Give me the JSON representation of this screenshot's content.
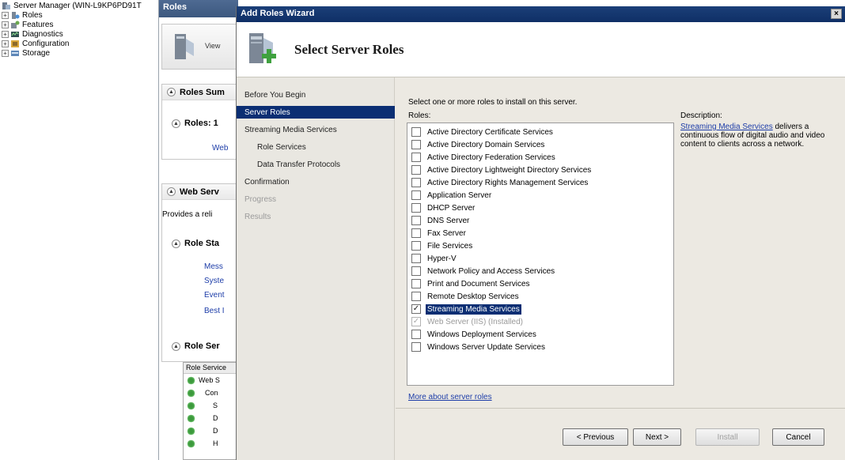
{
  "tree": {
    "root_label": "Server Manager (WIN-L9KP6PD91T",
    "items": [
      {
        "label": "Roles"
      },
      {
        "label": "Features"
      },
      {
        "label": "Diagnostics"
      },
      {
        "label": "Configuration"
      },
      {
        "label": "Storage"
      }
    ]
  },
  "mid": {
    "header": "Roles",
    "banner_text": "View",
    "roles_summary": "Roles Sum",
    "roles_count": "Roles: 1",
    "web_link": "Web",
    "web_server": "Web Serv",
    "provides": "Provides a reli",
    "role_status": "Role Sta",
    "status_links": [
      "Mess",
      "Syste",
      "Event",
      "Best I"
    ],
    "role_services": "Role Ser",
    "grid_header": "Role Service",
    "grid_rows": [
      "Web S",
      "Con",
      "S",
      "D",
      "D",
      "H"
    ]
  },
  "wizard": {
    "title": "Add Roles Wizard",
    "close": "×",
    "header_title": "Select Server Roles",
    "steps": [
      {
        "label": "Before You Begin"
      },
      {
        "label": "Server Roles"
      },
      {
        "label": "Streaming Media Services"
      },
      {
        "label": "Role Services"
      },
      {
        "label": "Data Transfer Protocols"
      },
      {
        "label": "Confirmation"
      },
      {
        "label": "Progress"
      },
      {
        "label": "Results"
      }
    ],
    "instruction": "Select one or more roles to install on this server.",
    "roles_label": "Roles:",
    "roles": [
      {
        "label": "Active Directory Certificate Services",
        "checked": false
      },
      {
        "label": "Active Directory Domain Services",
        "checked": false
      },
      {
        "label": "Active Directory Federation Services",
        "checked": false
      },
      {
        "label": "Active Directory Lightweight Directory Services",
        "checked": false
      },
      {
        "label": "Active Directory Rights Management Services",
        "checked": false
      },
      {
        "label": "Application Server",
        "checked": false
      },
      {
        "label": "DHCP Server",
        "checked": false
      },
      {
        "label": "DNS Server",
        "checked": false
      },
      {
        "label": "Fax Server",
        "checked": false
      },
      {
        "label": "File Services",
        "checked": false
      },
      {
        "label": "Hyper-V",
        "checked": false
      },
      {
        "label": "Network Policy and Access Services",
        "checked": false
      },
      {
        "label": "Print and Document Services",
        "checked": false
      },
      {
        "label": "Remote Desktop Services",
        "checked": false
      },
      {
        "label": "Streaming Media Services",
        "checked": true
      },
      {
        "label": "Web Server (IIS)  (Installed)",
        "checked": true
      },
      {
        "label": "Windows Deployment Services",
        "checked": false
      },
      {
        "label": "Windows Server Update Services",
        "checked": false
      }
    ],
    "description_label": "Description:",
    "description_link": "Streaming Media Services",
    "description_rest": " delivers a continuous flow of digital audio and video content to clients across a network.",
    "more_link": "More about server roles",
    "buttons": {
      "previous": "< Previous",
      "next": "Next >",
      "install": "Install",
      "cancel": "Cancel"
    }
  },
  "colors": {
    "title_bar": "#0f2f66",
    "selection": "#0b2e73",
    "link": "#1d3da8",
    "wizard_bg": "#ece9e2"
  }
}
